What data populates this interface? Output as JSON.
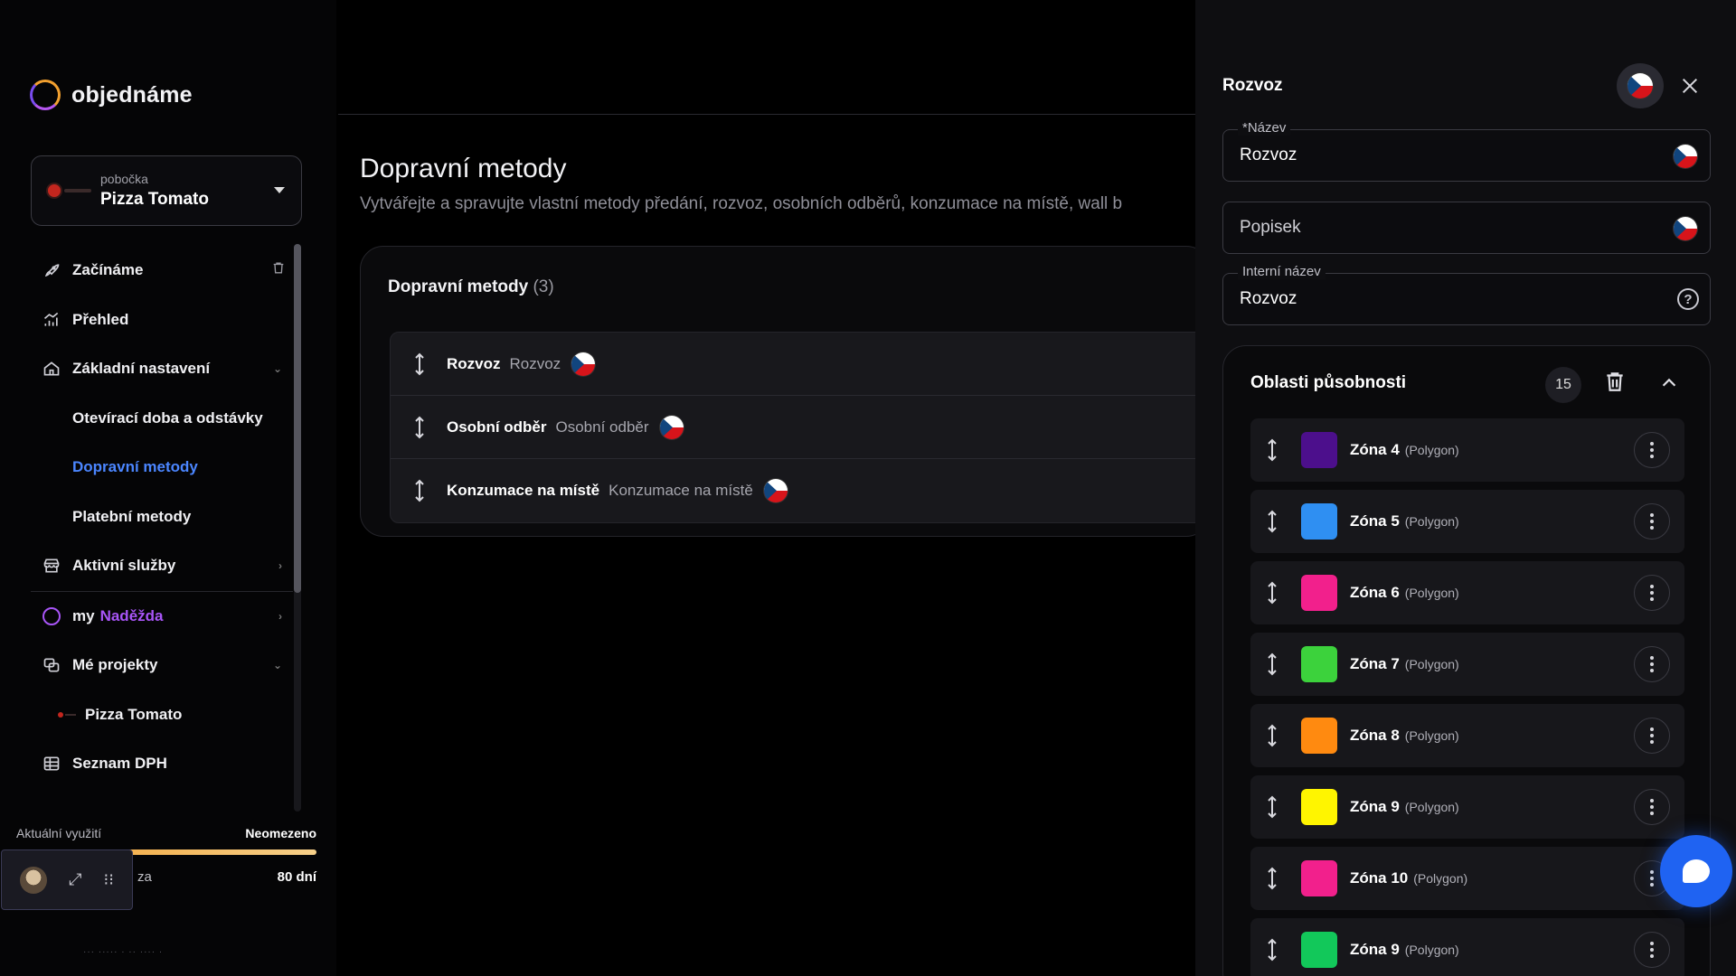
{
  "app": {
    "logo_text": "objednáme"
  },
  "branch": {
    "label": "pobočka",
    "name": "Pizza Tomato"
  },
  "sidebar": {
    "items": [
      {
        "label": "Začínáme"
      },
      {
        "label": "Přehled"
      },
      {
        "label": "Základní nastavení"
      },
      {
        "label": "Otevírací doba a odstávky"
      },
      {
        "label": "Dopravní metody"
      },
      {
        "label": "Platební metody"
      },
      {
        "label": "Aktivní služby"
      },
      {
        "label": "my",
        "label_accent": "Naděžda"
      },
      {
        "label": "Mé projekty"
      },
      {
        "label": "Pizza Tomato"
      },
      {
        "label": "Seznam DPH"
      }
    ]
  },
  "usage": {
    "label": "Aktuální využití",
    "value": "Neomezeno",
    "prefix": "za",
    "days": "80 dní",
    "fill_percent": 100
  },
  "footer": {
    "text": "··· ····· · ·· ···· ·"
  },
  "main": {
    "title": "Dopravní metody",
    "description": "Vytvářejte a spravujte vlastní metody předání, rozvoz, osobních odběrů, konzumace na místě, wall b",
    "card": {
      "title": "Dopravní metody",
      "count": "(3)",
      "methods": [
        {
          "name": "Rozvoz",
          "alt": "Rozvoz"
        },
        {
          "name": "Osobní odběr",
          "alt": "Osobní odběr"
        },
        {
          "name": "Konzumace na místě",
          "alt": "Konzumace na místě"
        }
      ]
    }
  },
  "drawer": {
    "title": "Rozvoz",
    "fields": {
      "name_label": "*Název",
      "name_value": "Rozvoz",
      "description_placeholder": "Popisek",
      "internal_label": "Interní název",
      "internal_value": "Rozvoz",
      "help_glyph": "?"
    },
    "zones": {
      "title": "Oblasti působnosti",
      "count": "15",
      "items": [
        {
          "name": "Zóna 4",
          "type": "(Polygon)",
          "color": "#4c0f8c"
        },
        {
          "name": "Zóna 5",
          "type": "(Polygon)",
          "color": "#2f8ff2"
        },
        {
          "name": "Zóna 6",
          "type": "(Polygon)",
          "color": "#f2208c"
        },
        {
          "name": "Zóna 7",
          "type": "(Polygon)",
          "color": "#3cd23c"
        },
        {
          "name": "Zóna 8",
          "type": "(Polygon)",
          "color": "#ff8a10"
        },
        {
          "name": "Zóna 9",
          "type": "(Polygon)",
          "color": "#fff500"
        },
        {
          "name": "Zóna 10",
          "type": "(Polygon)",
          "color": "#f2208c"
        },
        {
          "name": "Zóna 9",
          "type": "(Polygon)",
          "color": "#12c85a"
        }
      ]
    }
  },
  "colors": {
    "accent": "#4b86ff",
    "brand_purple": "#a855f7",
    "fab": "#1f63f2"
  },
  "icons": {
    "rocket": "rocket-icon",
    "chart": "bar-chart-icon",
    "home": "home-icon",
    "store": "store-icon",
    "projects": "projects-icon",
    "table": "table-icon",
    "trash": "trash-icon",
    "close": "close-icon",
    "help": "help-icon"
  }
}
